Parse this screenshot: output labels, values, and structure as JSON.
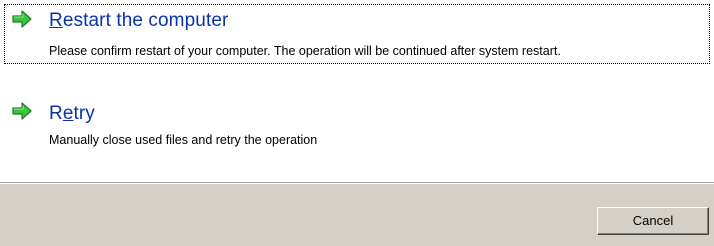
{
  "options": [
    {
      "title_prefix": "",
      "title_mnemonic": "R",
      "title_rest": "estart the computer",
      "description": "Please confirm restart of your computer. The operation will be continued after system restart.",
      "icon": "green-arrow-right-icon"
    },
    {
      "title_prefix": "R",
      "title_mnemonic": "e",
      "title_rest": "try",
      "description": "Manually close used files and retry the operation",
      "icon": "green-arrow-right-icon"
    }
  ],
  "footer": {
    "cancel_label": "Cancel"
  },
  "colors": {
    "title": "#0b33a8",
    "arrow_fill": "#35c83a",
    "arrow_stroke": "#1f7a24",
    "footer_bg": "#d4d0c8"
  }
}
